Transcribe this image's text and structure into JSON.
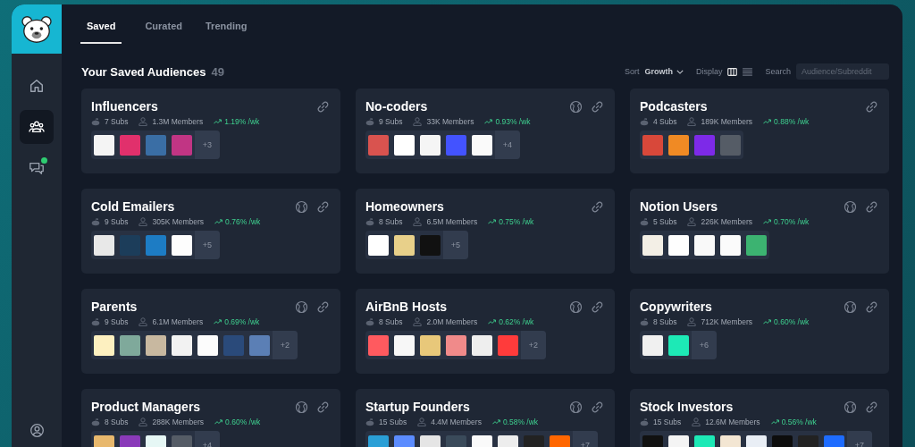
{
  "sidebar": {
    "nav": [
      {
        "kind": "home",
        "selected": false,
        "badge": false
      },
      {
        "kind": "audiences",
        "selected": true,
        "badge": false
      },
      {
        "kind": "chat",
        "selected": false,
        "badge": true
      }
    ]
  },
  "tabs": [
    {
      "label": "Saved",
      "selected": true
    },
    {
      "label": "Curated",
      "selected": false
    },
    {
      "label": "Trending",
      "selected": false
    }
  ],
  "header": {
    "title": "Your Saved Audiences",
    "count": "49"
  },
  "toolbar": {
    "sort_label": "Sort",
    "sort_value": "Growth",
    "display_label": "Display",
    "display_options": [
      {
        "kind": "grid",
        "selected": true
      },
      {
        "kind": "list",
        "selected": false
      }
    ],
    "search_label": "Search",
    "search": {
      "placeholder": "Audience/Subreddit"
    }
  },
  "cards": [
    {
      "title": "Influencers",
      "public": false,
      "subs": "7 Subs",
      "members": "1.3M Members",
      "growth": "1.19% /wk",
      "icons": [
        {
          "color": "#f4f4f4"
        },
        {
          "color": "#e1306c"
        },
        {
          "color": "#3a6ea5"
        },
        {
          "color": "#c13584"
        }
      ],
      "more": "+3"
    },
    {
      "title": "No-coders",
      "public": true,
      "subs": "9 Subs",
      "members": "33K Members",
      "growth": "0.93% /wk",
      "icons": [
        {
          "color": "#d9534f"
        },
        {
          "color": "#ffffff"
        },
        {
          "color": "#f5f5f5"
        },
        {
          "color": "#4353ff"
        },
        {
          "color": "#fafafa"
        }
      ],
      "more": "+4"
    },
    {
      "title": "Podcasters",
      "public": false,
      "subs": "4 Subs",
      "members": "189K Members",
      "growth": "0.88% /wk",
      "icons": [
        {
          "color": "#d8483a"
        },
        {
          "color": "#f08a24"
        },
        {
          "color": "#7d2ae8"
        },
        {
          "color": "#555c66"
        }
      ]
    },
    {
      "title": "Cold Emailers",
      "public": true,
      "subs": "9 Subs",
      "members": "305K Members",
      "growth": "0.76% /wk",
      "icons": [
        {
          "color": "#e8e8e8"
        },
        {
          "color": "#1c3d5a"
        },
        {
          "color": "#1d7cc4"
        },
        {
          "color": "#fdfdfd"
        }
      ],
      "more": "+5"
    },
    {
      "title": "Homeowners",
      "public": false,
      "subs": "8 Subs",
      "members": "6.5M Members",
      "growth": "0.75% /wk",
      "icons": [
        {
          "color": "#ffffff"
        },
        {
          "color": "#e8d08a"
        },
        {
          "color": "#111111"
        }
      ],
      "more": "+5"
    },
    {
      "title": "Notion Users",
      "public": true,
      "subs": "5 Subs",
      "members": "226K Members",
      "growth": "0.70% /wk",
      "icons": [
        {
          "color": "#f3efe6"
        },
        {
          "color": "#fefefe"
        },
        {
          "color": "#f9f9f9"
        },
        {
          "color": "#fbfbfb"
        },
        {
          "color": "#3cb371"
        }
      ]
    },
    {
      "title": "Parents",
      "public": true,
      "subs": "9 Subs",
      "members": "6.1M Members",
      "growth": "0.69% /wk",
      "icons": [
        {
          "color": "#fdf0c0"
        },
        {
          "color": "#7fa99b"
        },
        {
          "color": "#c8b8a0"
        },
        {
          "color": "#f2f2f2"
        },
        {
          "color": "#fcfcfc"
        },
        {
          "color": "#2a4a7a"
        },
        {
          "color": "#5b7fb5"
        }
      ],
      "more": "+2"
    },
    {
      "title": "AirBnB Hosts",
      "public": true,
      "subs": "8 Subs",
      "members": "2.0M Members",
      "growth": "0.62% /wk",
      "icons": [
        {
          "color": "#ff5a5f"
        },
        {
          "color": "#f7f7f7"
        },
        {
          "color": "#e8c87a"
        },
        {
          "color": "#f08a8a"
        },
        {
          "color": "#eeeeee"
        },
        {
          "color": "#ff3b3b"
        }
      ],
      "more": "+2"
    },
    {
      "title": "Copywriters",
      "public": true,
      "subs": "8 Subs",
      "members": "712K Members",
      "growth": "0.60% /wk",
      "icons": [
        {
          "color": "#f0f0f0"
        },
        {
          "color": "#1de9b6"
        }
      ],
      "more": "+6"
    },
    {
      "title": "Product Managers",
      "public": true,
      "subs": "8 Subs",
      "members": "288K Members",
      "growth": "0.60% /wk",
      "icons": [
        {
          "color": "#e8b86d"
        },
        {
          "color": "#8a3ab9"
        },
        {
          "color": "#e6f7f5"
        },
        {
          "color": "#555c66"
        }
      ],
      "more": "+4"
    },
    {
      "title": "Startup Founders",
      "public": true,
      "subs": "15 Subs",
      "members": "4.4M Members",
      "growth": "0.58% /wk",
      "icons": [
        {
          "color": "#2a9fd6"
        },
        {
          "color": "#5b8cff"
        },
        {
          "color": "#e5e5e5"
        },
        {
          "color": "#3a4a5a"
        },
        {
          "color": "#fafafa"
        },
        {
          "color": "#ededed"
        },
        {
          "color": "#222222"
        },
        {
          "color": "#ff6600"
        }
      ],
      "more": "+7"
    },
    {
      "title": "Stock Investors",
      "public": true,
      "subs": "15 Subs",
      "members": "12.6M Members",
      "growth": "0.56% /wk",
      "icons": [
        {
          "color": "#111111"
        },
        {
          "color": "#f4f4f4"
        },
        {
          "color": "#1de9b6"
        },
        {
          "color": "#f3e6d3"
        },
        {
          "color": "#e9eef5"
        },
        {
          "color": "#0d0d0d"
        },
        {
          "color": "#222222"
        },
        {
          "color": "#1e6cff"
        }
      ],
      "more": "+7"
    }
  ]
}
